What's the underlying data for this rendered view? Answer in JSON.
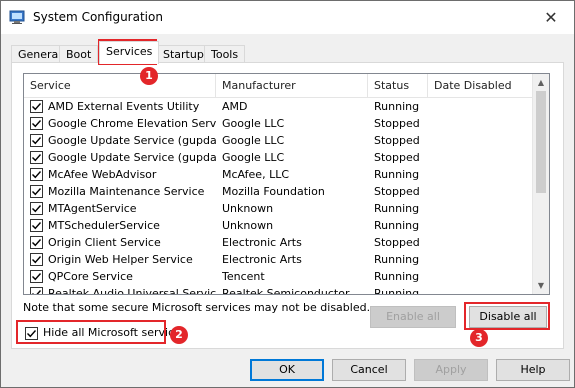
{
  "window": {
    "title": "System Configuration",
    "close_glyph": "✕",
    "app_icon": "msconfig-icon"
  },
  "tabs": [
    {
      "label": "General"
    },
    {
      "label": "Boot"
    },
    {
      "label": "Services",
      "active": true
    },
    {
      "label": "Startup"
    },
    {
      "label": "Tools"
    }
  ],
  "table": {
    "columns": [
      "Service",
      "Manufacturer",
      "Status",
      "Date Disabled"
    ],
    "rows": [
      {
        "service": "AMD External Events Utility",
        "manufacturer": "AMD",
        "status": "Running",
        "date_disabled": "",
        "checked": true
      },
      {
        "service": "Google Chrome Elevation Service",
        "manufacturer": "Google LLC",
        "status": "Stopped",
        "date_disabled": "",
        "checked": true
      },
      {
        "service": "Google Update Service (gupdate)",
        "manufacturer": "Google LLC",
        "status": "Stopped",
        "date_disabled": "",
        "checked": true
      },
      {
        "service": "Google Update Service (gupdatem)",
        "manufacturer": "Google LLC",
        "status": "Stopped",
        "date_disabled": "",
        "checked": true
      },
      {
        "service": "McAfee WebAdvisor",
        "manufacturer": "McAfee, LLC",
        "status": "Running",
        "date_disabled": "",
        "checked": true
      },
      {
        "service": "Mozilla Maintenance Service",
        "manufacturer": "Mozilla Foundation",
        "status": "Stopped",
        "date_disabled": "",
        "checked": true
      },
      {
        "service": "MTAgentService",
        "manufacturer": "Unknown",
        "status": "Running",
        "date_disabled": "",
        "checked": true
      },
      {
        "service": "MTSchedulerService",
        "manufacturer": "Unknown",
        "status": "Running",
        "date_disabled": "",
        "checked": true
      },
      {
        "service": "Origin Client Service",
        "manufacturer": "Electronic Arts",
        "status": "Stopped",
        "date_disabled": "",
        "checked": true
      },
      {
        "service": "Origin Web Helper Service",
        "manufacturer": "Electronic Arts",
        "status": "Running",
        "date_disabled": "",
        "checked": true
      },
      {
        "service": "QPCore Service",
        "manufacturer": "Tencent",
        "status": "Running",
        "date_disabled": "",
        "checked": true
      },
      {
        "service": "Realtek Audio Universal Service",
        "manufacturer": "Realtek Semiconductor",
        "status": "Running",
        "date_disabled": "",
        "checked": true
      }
    ]
  },
  "note": "Note that some secure Microsoft services may not be disabled.",
  "buttons": {
    "enable_all": "Enable all",
    "disable_all": "Disable all",
    "ok": "OK",
    "cancel": "Cancel",
    "apply": "Apply",
    "help": "Help"
  },
  "hide_ms": {
    "label": "Hide all Microsoft services",
    "checked": true
  },
  "annotations": {
    "badge1": "1",
    "badge2": "2",
    "badge3": "3",
    "color": "#e3262a"
  }
}
